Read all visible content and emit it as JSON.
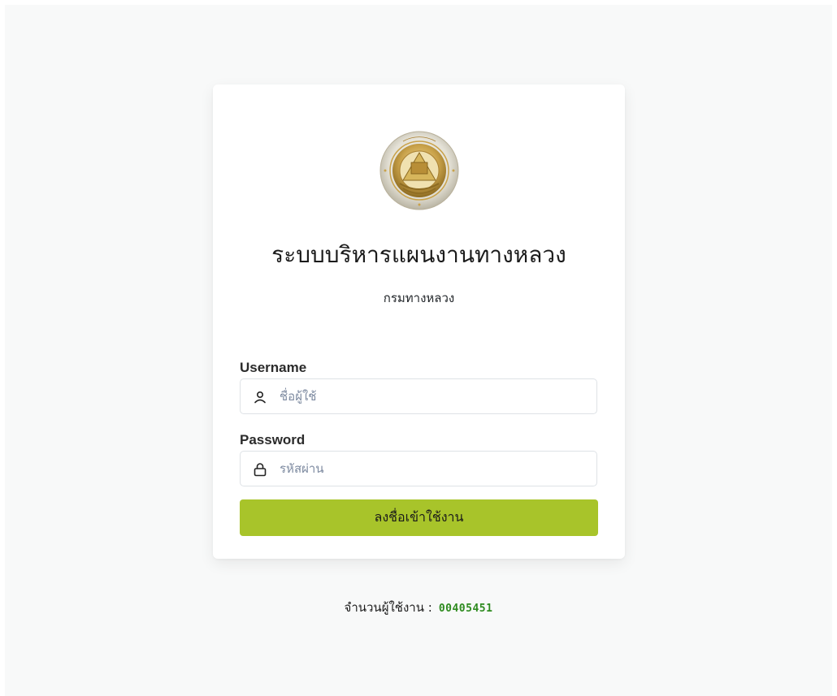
{
  "header": {
    "title": "ระบบบริหารแผนงานทางหลวง",
    "subtitle": "กรมทางหลวง",
    "logo_icon": "department-of-highways-seal",
    "logo_text": "กรมทางหลวง"
  },
  "form": {
    "username": {
      "label": "Username",
      "placeholder": "ชื่อผู้ใช้",
      "value": "",
      "icon": "user-icon"
    },
    "password": {
      "label": "Password",
      "placeholder": "รหัสผ่าน",
      "value": "",
      "icon": "lock-icon"
    },
    "submit_label": "ลงชื่อเข้าใช้งาน"
  },
  "footer": {
    "counter_label": "จำนวนผู้ใช้งาน :",
    "counter_value": "00405451"
  },
  "colors": {
    "accent": "#a8c42a",
    "counter": "#2e8b1f",
    "background": "#f8f9f9"
  }
}
